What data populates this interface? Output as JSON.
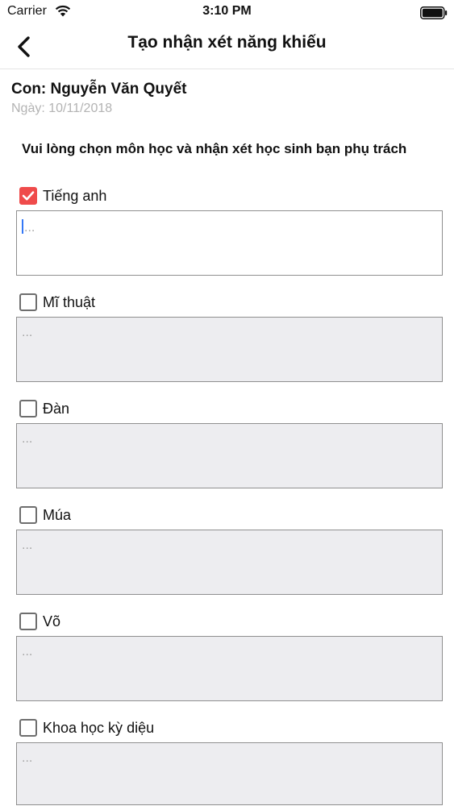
{
  "status_bar": {
    "carrier": "Carrier",
    "time": "3:10 PM"
  },
  "nav": {
    "title": "Tạo nhận xét năng khiếu"
  },
  "child": {
    "name": "Con: Nguyễn Văn Quyết",
    "date": "Ngày: 10/11/2018"
  },
  "instruction": "Vui lòng chọn môn học và nhận xét học sinh bạn phụ trách",
  "comment_placeholder": "...",
  "subjects": [
    {
      "label": "Tiếng anh",
      "checked": true
    },
    {
      "label": "Mĩ thuật",
      "checked": false
    },
    {
      "label": "Đàn",
      "checked": false
    },
    {
      "label": "Múa",
      "checked": false
    },
    {
      "label": "Võ",
      "checked": false
    },
    {
      "label": "Khoa học kỳ diệu",
      "checked": false
    }
  ],
  "colors": {
    "accent": "#ef4b4b",
    "input_bg": "#ededf0",
    "caret": "#3478f6"
  }
}
